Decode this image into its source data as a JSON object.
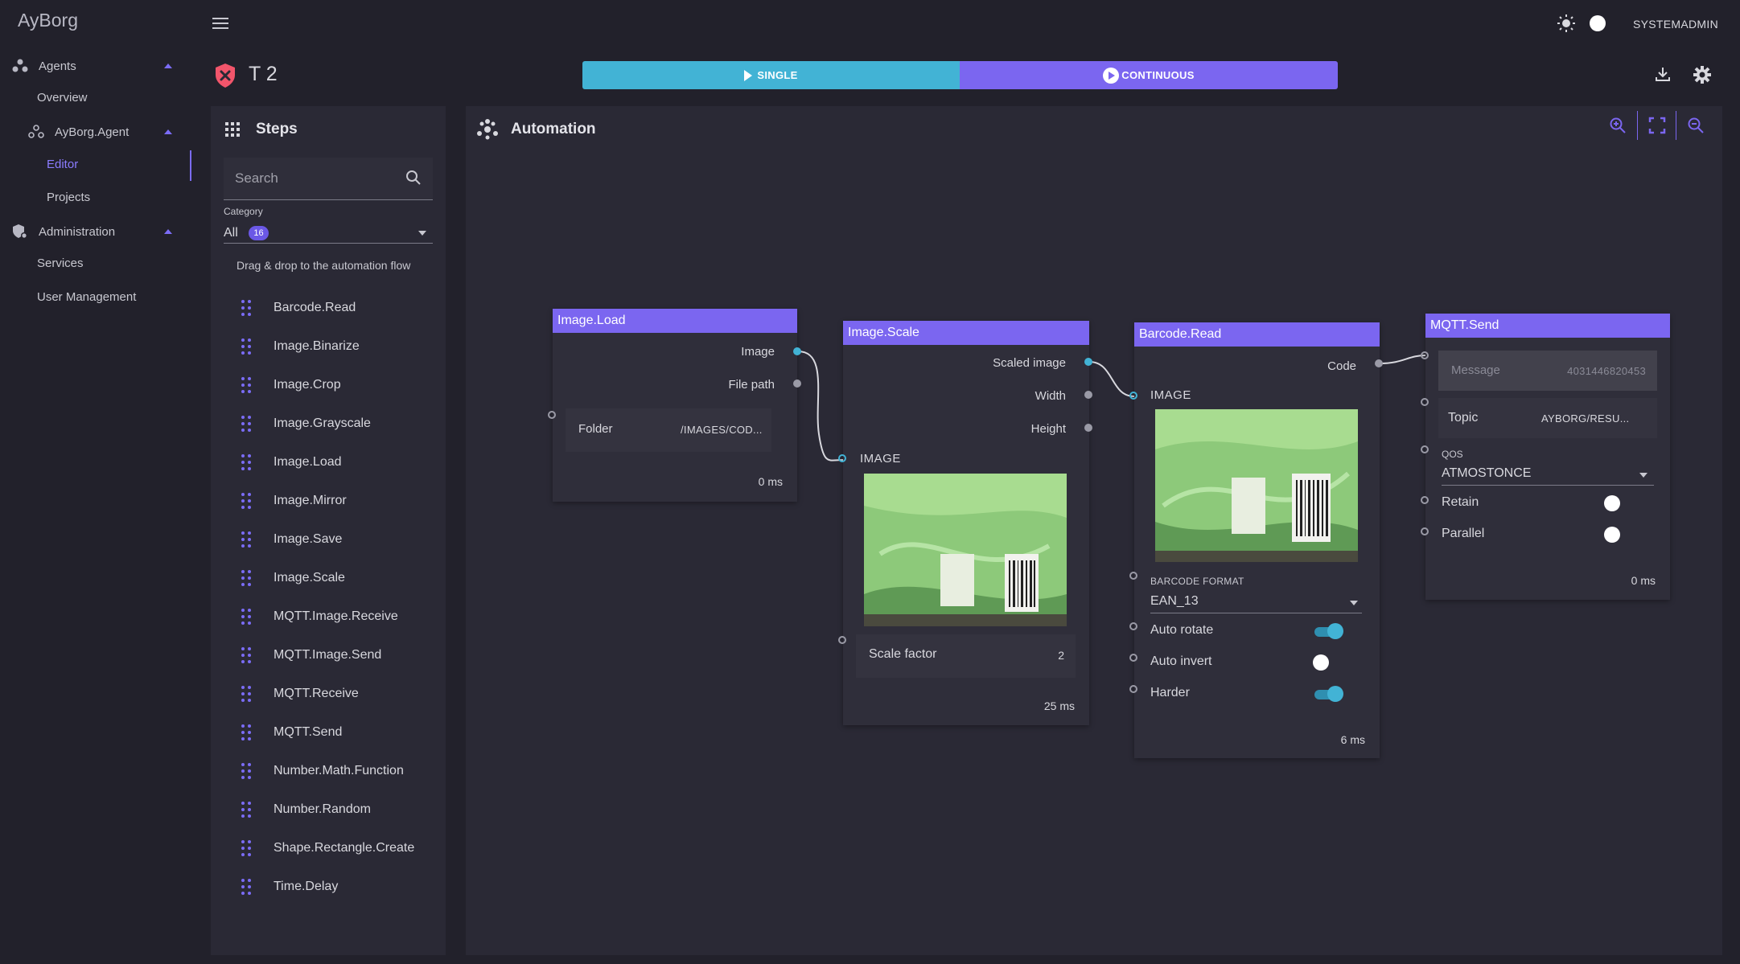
{
  "app": {
    "brand": "AyBorg",
    "username": "SYSTEMADMIN"
  },
  "sidebar": {
    "agents": "Agents",
    "overview": "Overview",
    "agent_name": "AyBorg.Agent",
    "editor": "Editor",
    "projects": "Projects",
    "administration": "Administration",
    "services": "Services",
    "user_management": "User Management"
  },
  "header": {
    "project_title": "T 2",
    "single_label": "SINGLE",
    "continuous_label": "CONTINUOUS"
  },
  "steps_panel": {
    "title": "Steps",
    "search_placeholder": "Search",
    "category_label": "Category",
    "category_value": "All",
    "category_count": "16",
    "drag_hint": "Drag & drop to the automation flow",
    "items": [
      "Barcode.Read",
      "Image.Binarize",
      "Image.Crop",
      "Image.Grayscale",
      "Image.Load",
      "Image.Mirror",
      "Image.Save",
      "Image.Scale",
      "MQTT.Image.Receive",
      "MQTT.Image.Send",
      "MQTT.Receive",
      "MQTT.Send",
      "Number.Math.Function",
      "Number.Random",
      "Shape.Rectangle.Create",
      "Time.Delay"
    ]
  },
  "automation": {
    "title": "Automation",
    "nodes": {
      "image_load": {
        "title": "Image.Load",
        "out_image": "Image",
        "out_file_path": "File path",
        "folder_label": "Folder",
        "folder_value": "/IMAGES/COD...",
        "time": "0 ms"
      },
      "image_scale": {
        "title": "Image.Scale",
        "out_scaled_image": "Scaled image",
        "out_width": "Width",
        "out_height": "Height",
        "in_image": "IMAGE",
        "scale_label": "Scale factor",
        "scale_value": "2",
        "time": "25 ms"
      },
      "barcode_read": {
        "title": "Barcode.Read",
        "out_code": "Code",
        "in_image": "IMAGE",
        "format_label": "BARCODE FORMAT",
        "format_value": "EAN_13",
        "auto_rotate": "Auto rotate",
        "auto_invert": "Auto invert",
        "harder": "Harder",
        "time": "6 ms",
        "auto_rotate_on": true,
        "auto_invert_on": false,
        "harder_on": true
      },
      "mqtt_send": {
        "title": "MQTT.Send",
        "message_label": "Message",
        "message_value": "4031446820453",
        "topic_label": "Topic",
        "topic_value": "AYBORG/RESU...",
        "qos_label": "QOS",
        "qos_value": "ATMOSTONCE",
        "retain": "Retain",
        "parallel": "Parallel",
        "time": "0 ms"
      }
    }
  },
  "colors": {
    "accent": "#7b66f0",
    "cyan": "#42b3d5",
    "background": "#22212b",
    "panel": "#2a2935"
  }
}
